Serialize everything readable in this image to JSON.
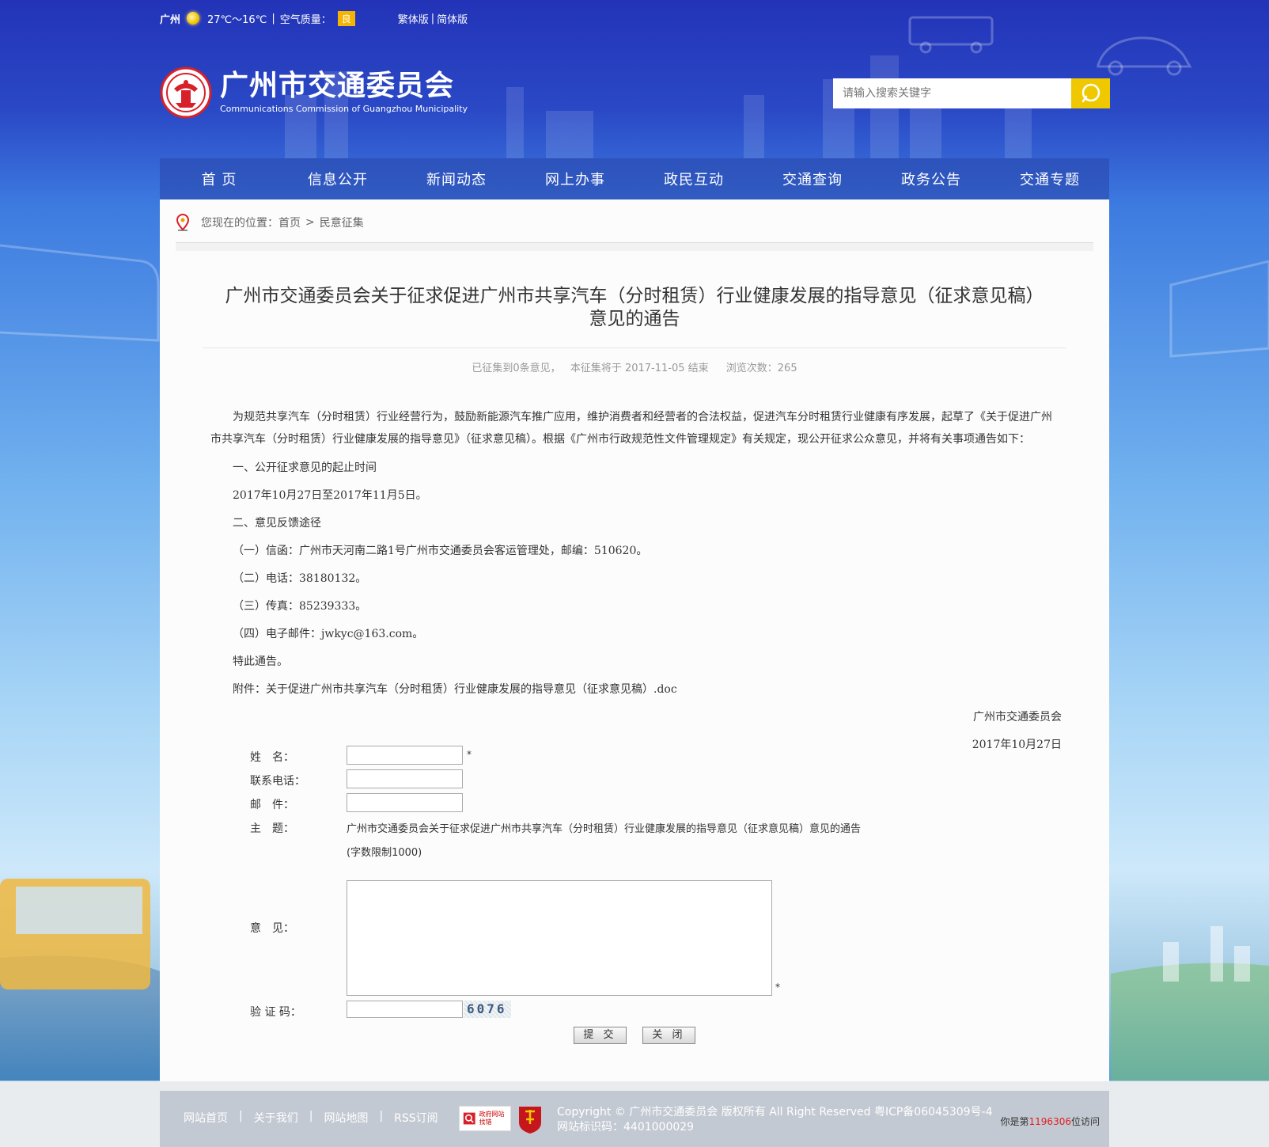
{
  "topbar": {
    "city": "广州",
    "weather_icon": "sun-icon",
    "temperature": "27℃～16℃",
    "sep": "|",
    "aqi_label": "空气质量：",
    "aqi_value": "良",
    "lang_traditional": "繁体版",
    "lang_sep": "|",
    "lang_simplified": "简体版"
  },
  "header": {
    "title": "广州市交通委员会",
    "subtitle": "Communications Commission of Guangzhou Municipality",
    "search_placeholder": "请输入搜索关键字"
  },
  "nav": {
    "items": [
      {
        "label": "首 页"
      },
      {
        "label": "信息公开"
      },
      {
        "label": "新闻动态"
      },
      {
        "label": "网上办事"
      },
      {
        "label": "政民互动"
      },
      {
        "label": "交通查询"
      },
      {
        "label": "政务公告"
      },
      {
        "label": "交通专题"
      }
    ]
  },
  "breadcrumb": {
    "prefix": "您现在的位置：",
    "home": "首页",
    "sep": ">",
    "current": "民意征集"
  },
  "article": {
    "title_line1": "广州市交通委员会关于征求促进广州市共享汽车（分时租赁）行业健康发展的指导意见（征求意见稿）",
    "title_line2": "意见的通告",
    "meta_collected": "已征集到0条意见，",
    "meta_end": "本征集将于 2017-11-05 结束",
    "meta_views": "浏览次数：265",
    "intro": "为规范共享汽车（分时租赁）行业经营行为，鼓励新能源汽车推广应用，维护消费者和经营者的合法权益，促进汽车分时租赁行业健康有序发展，起草了《关于促进广州市共享汽车（分时租赁）行业健康发展的指导意见》（征求意见稿）。根据《广州市行政规范性文件管理规定》有关规定，现公开征求公众意见，并将有关事项通告如下：",
    "section1": "一、公开征求意见的起止时间",
    "period": "2017年10月27日至2017年11月5日。",
    "section2": "二、意见反馈途径",
    "letter": "（一）信函：广州市天河南二路1号广州市交通委员会客运管理处，邮编：510620。",
    "phone": "（二）电话：38180132。",
    "fax": "（三）传真：85239333。",
    "email": "（四）电子邮件：jwkyc@163.com。",
    "closing": "特此通告。",
    "attachment": "附件：关于促进广州市共享汽车（分时租赁）行业健康发展的指导意见（征求意见稿）.doc",
    "signature": "广州市交通委员会",
    "date": "2017年10月27日"
  },
  "form": {
    "name_label": "姓　名：",
    "phone_label": "联系电话：",
    "email_label": "邮　件：",
    "subject_label": "主　题：",
    "subject_value": "广州市交通委员会关于征求促进广州市共享汽车（分时租赁）行业健康发展的指导意见（征求意见稿）意见的通告",
    "limit_note": "(字数限制1000)",
    "opinion_label": "意　见：",
    "captcha_label": "验 证 码：",
    "captcha_code": "6076",
    "required_mark": "*",
    "submit": "提 交",
    "close": "关 闭"
  },
  "footer": {
    "links": [
      {
        "label": "网站首页"
      },
      {
        "label": "关于我们"
      },
      {
        "label": "网站地图"
      },
      {
        "label": "RSS订阅"
      }
    ],
    "link_sep": "|",
    "badge1": "政府网站找错",
    "copyright": "Copyright © 广州市交通委员会 版权所有 All Right Reserved 粤ICP备06045309号-4",
    "site_id": "网站标识码：4401000029",
    "visit_prefix": "你是第",
    "visit_count": "1196306",
    "visit_suffix": "位访问"
  },
  "colors": {
    "accent_yellow": "#f0c800",
    "aqi_orange": "#f5b400",
    "logo_red": "#d8202a",
    "visit_red": "#e02020"
  }
}
